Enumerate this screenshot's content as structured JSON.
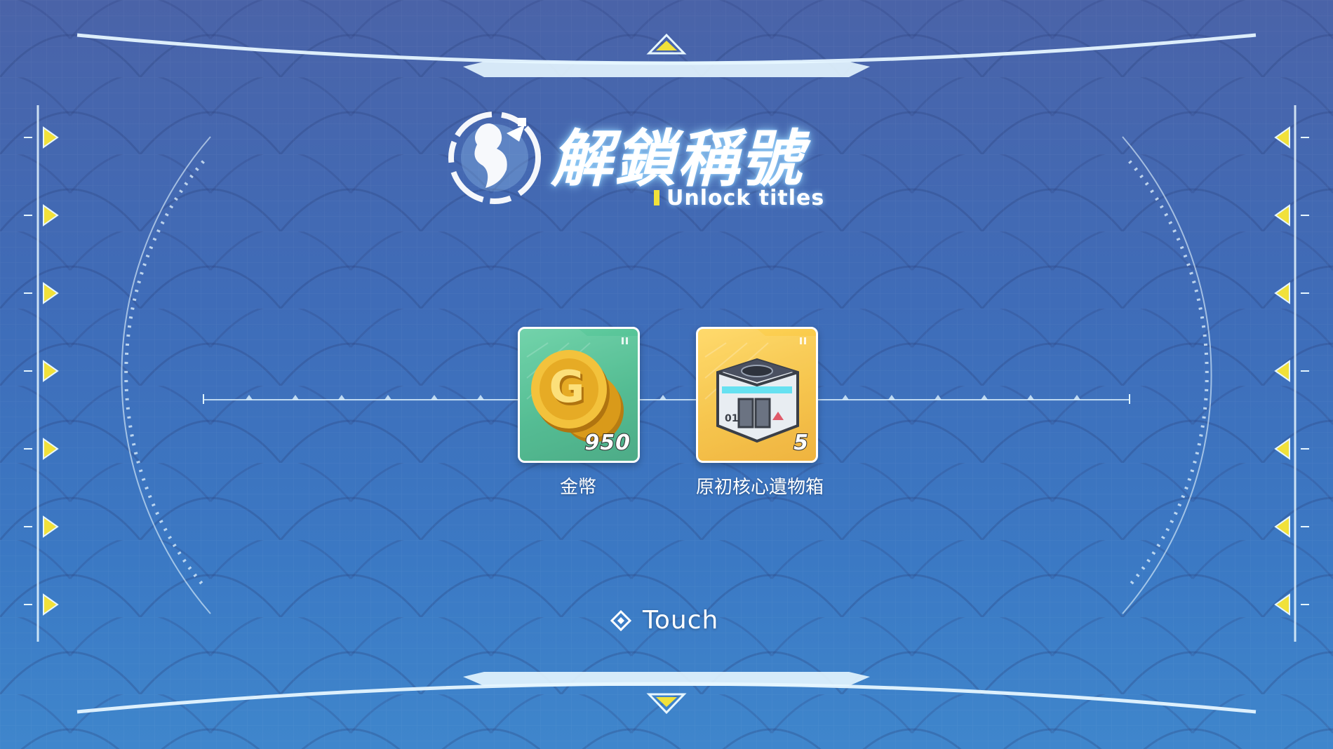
{
  "screen": {
    "title_cn": "解鎖稱號",
    "title_en": "Unlock titles",
    "emblem_icon": "character-emblem-icon"
  },
  "rewards": [
    {
      "name": "金幣",
      "quantity": "950",
      "icon": "gold-coin-icon",
      "rarity_color": "#4cbd8f"
    },
    {
      "name": "原初核心遺物箱",
      "quantity": "5",
      "icon": "relic-box-icon",
      "rarity_color": "#f5bf3a"
    }
  ],
  "prompt": {
    "label": "Touch",
    "icon": "diamond-icon"
  },
  "colors": {
    "background": "#3f6cb8",
    "accent_yellow": "#f1e13a",
    "frame_line": "#dff4ff"
  }
}
